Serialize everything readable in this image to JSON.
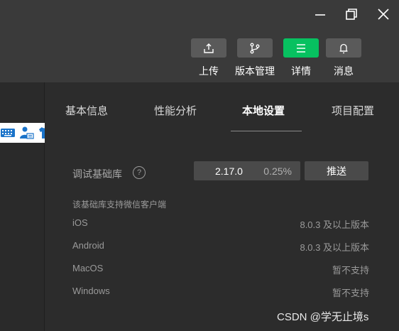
{
  "toolbar": {
    "upload_label": "上传",
    "version_label": "版本管理",
    "details_label": "详情",
    "messages_label": "消息"
  },
  "tabs": [
    "基本信息",
    "性能分析",
    "本地设置",
    "项目配置"
  ],
  "settings": {
    "lib_label": "调试基础库",
    "help": "?",
    "lib_version": "2.17.0",
    "lib_percent": "0.25%",
    "push_label": "推送",
    "support_title": "该基础库支持微信客户端",
    "platforms": [
      {
        "name": "iOS",
        "value": "8.0.3 及以上版本"
      },
      {
        "name": "Android",
        "value": "8.0.3 及以上版本"
      },
      {
        "name": "MacOS",
        "value": "暂不支持"
      },
      {
        "name": "Windows",
        "value": "暂不支持"
      }
    ]
  },
  "watermark": "CSDN @学无止境s",
  "colors": {
    "accent": "#07c160",
    "button": "#5a5a5a",
    "background": "#2c2c2c"
  }
}
